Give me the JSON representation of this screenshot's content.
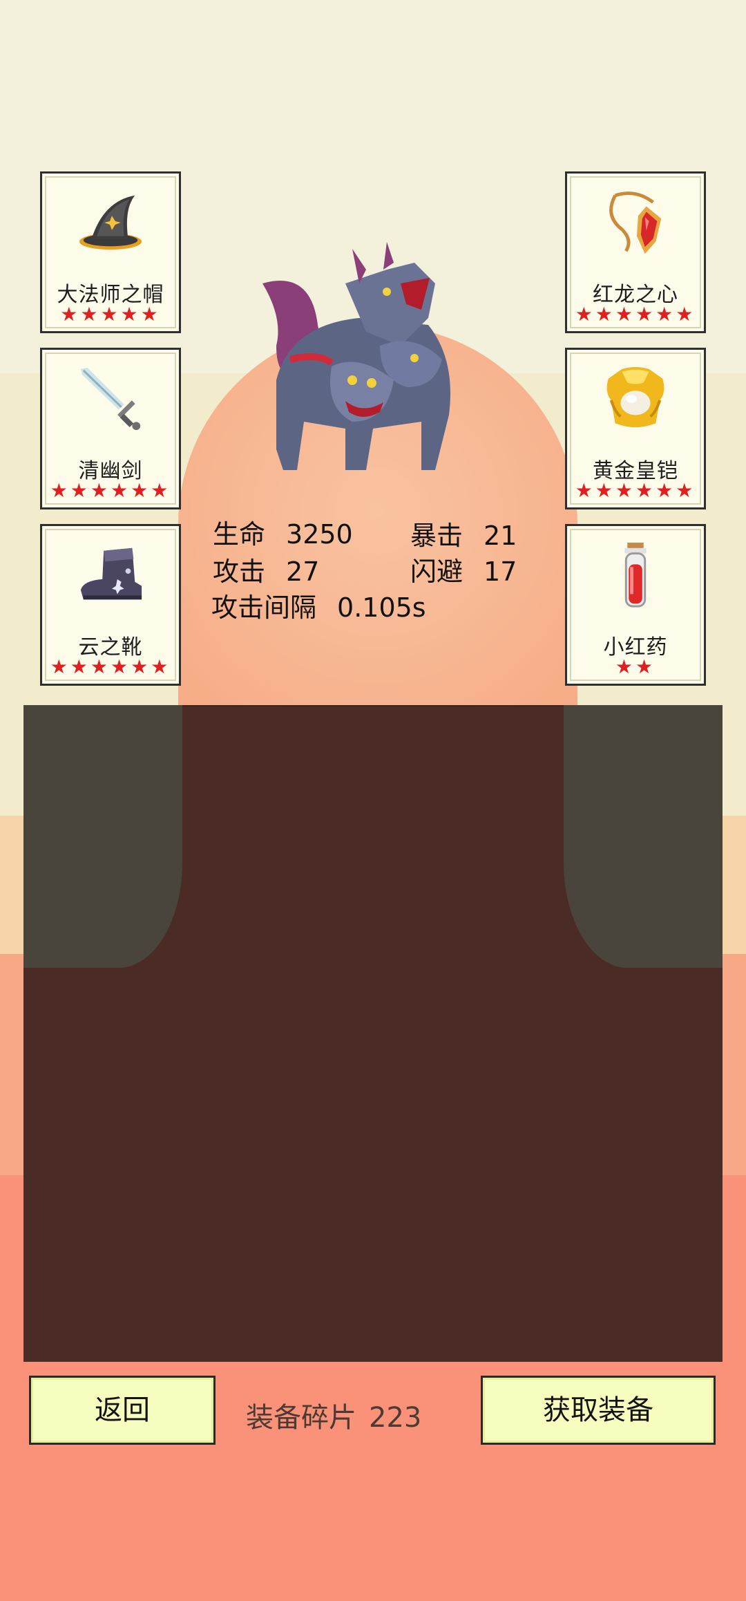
{
  "equipment": {
    "left": [
      {
        "name": "大法师之帽",
        "stars": "★★★★★",
        "icon": "wizard-hat-icon"
      },
      {
        "name": "清幽剑",
        "stars": "★★★★★★",
        "icon": "sword-icon"
      },
      {
        "name": "云之靴",
        "stars": "★★★★★★",
        "icon": "boots-icon"
      }
    ],
    "right": [
      {
        "name": "红龙之心",
        "stars": "★★★★★★",
        "icon": "amulet-icon"
      },
      {
        "name": "黄金皇铠",
        "stars": "★★★★★★",
        "icon": "gold-armor-icon"
      },
      {
        "name": "小红药",
        "stars": "★★",
        "icon": "red-potion-icon"
      }
    ]
  },
  "monster": {
    "icon": "three-headed-dragon-hound"
  },
  "stats": {
    "hp_label": "生命",
    "hp_value": "3250",
    "crit_label": "暴击",
    "crit_value": "21",
    "atk_label": "攻击",
    "atk_value": "27",
    "dodge_label": "闪避",
    "dodge_value": "17",
    "interval_label": "攻击间隔",
    "interval_value": "0.105s"
  },
  "footer": {
    "back_label": "返回",
    "shards_label": "装备碎片",
    "shards_value": "223",
    "get_label": "获取装备"
  },
  "colors": {
    "star": "#e02020",
    "panel": "#4a2b25",
    "button": "#f7fdbf"
  }
}
